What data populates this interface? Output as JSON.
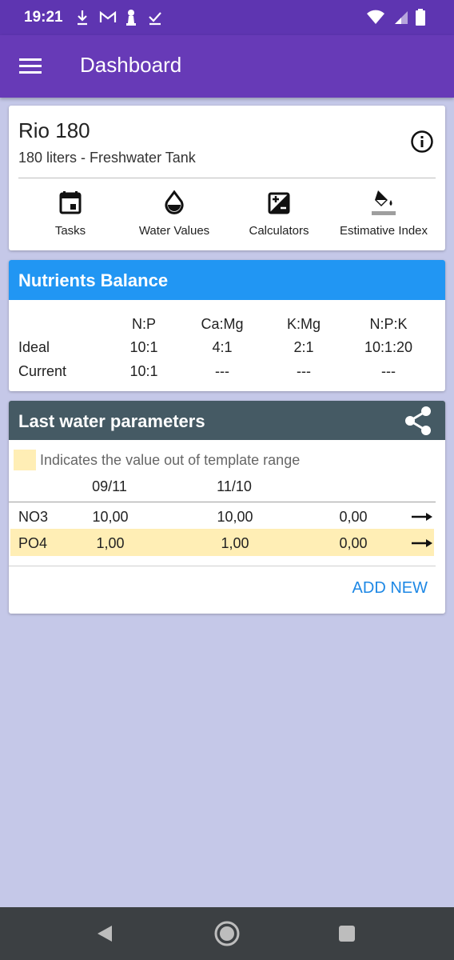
{
  "status": {
    "time": "19:21"
  },
  "appbar": {
    "title": "Dashboard"
  },
  "tank": {
    "name": "Rio 180",
    "description": "180 liters - Freshwater Tank",
    "actions": [
      {
        "label": "Tasks",
        "icon": "calendar-icon"
      },
      {
        "label": "Water Values",
        "icon": "water-drop-icon"
      },
      {
        "label": "Calculators",
        "icon": "calculator-icon"
      },
      {
        "label": "Estimative Index",
        "icon": "paint-bucket-icon"
      }
    ]
  },
  "nutrients": {
    "title": "Nutrients Balance",
    "columns": [
      "N:P",
      "Ca:Mg",
      "K:Mg",
      "N:P:K"
    ],
    "rows": [
      {
        "label": "Ideal",
        "values": [
          "10:1",
          "4:1",
          "2:1",
          "10:1:20"
        ]
      },
      {
        "label": "Current",
        "values": [
          "10:1",
          "---",
          "---",
          "---"
        ]
      }
    ]
  },
  "water": {
    "title": "Last water parameters",
    "legend": "Indicates the value out of template range",
    "highlight_color": "#ffeeb5",
    "dates": [
      "09/11",
      "11/10"
    ],
    "rows": [
      {
        "param": "NO3",
        "values": [
          "10,00",
          "10,00",
          "0,00"
        ],
        "out_of_range": false
      },
      {
        "param": "PO4",
        "values": [
          "1,00",
          "1,00",
          "0,00"
        ],
        "out_of_range": true
      }
    ],
    "add_new": "ADD NEW"
  },
  "colors": {
    "primary": "#673ab7",
    "status": "#5e35b1",
    "blue": "#2196f3",
    "slate": "#455a64",
    "background": "#c5c8e8"
  }
}
